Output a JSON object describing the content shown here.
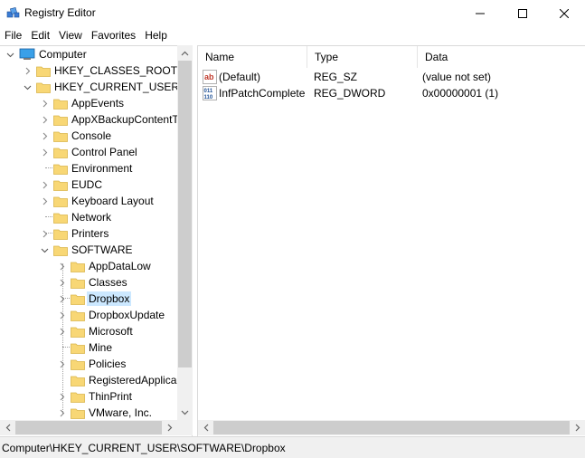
{
  "window": {
    "title": "Registry Editor"
  },
  "menu": [
    "File",
    "Edit",
    "View",
    "Favorites",
    "Help"
  ],
  "tree": {
    "root": "Computer",
    "hives": [
      "HKEY_CLASSES_ROOT",
      "HKEY_CURRENT_USER"
    ],
    "current_user_keys": [
      "AppEvents",
      "AppXBackupContentT",
      "Console",
      "Control Panel",
      "Environment",
      "EUDC",
      "Keyboard Layout",
      "Network",
      "Printers",
      "SOFTWARE"
    ],
    "software_keys": [
      "AppDataLow",
      "Classes",
      "Dropbox",
      "DropboxUpdate",
      "Microsoft",
      "Mine",
      "Policies",
      "RegisteredApplica",
      "ThinPrint",
      "VMware, Inc."
    ],
    "selected": "Dropbox"
  },
  "values": {
    "columns": [
      "Name",
      "Type",
      "Data"
    ],
    "rows": [
      {
        "name": "(Default)",
        "type": "REG_SZ",
        "data": "(value not set)",
        "icon": "string-value-icon"
      },
      {
        "name": "InfPatchComplete",
        "type": "REG_DWORD",
        "data": "0x00000001 (1)",
        "icon": "binary-value-icon"
      }
    ]
  },
  "status": {
    "path": "Computer\\HKEY_CURRENT_USER\\SOFTWARE\\Dropbox"
  },
  "colors": {
    "selection": "#cce8ff",
    "folder": "#f8d775",
    "scroll_track": "#f0f0f0",
    "scroll_thumb": "#cdcdcd"
  }
}
